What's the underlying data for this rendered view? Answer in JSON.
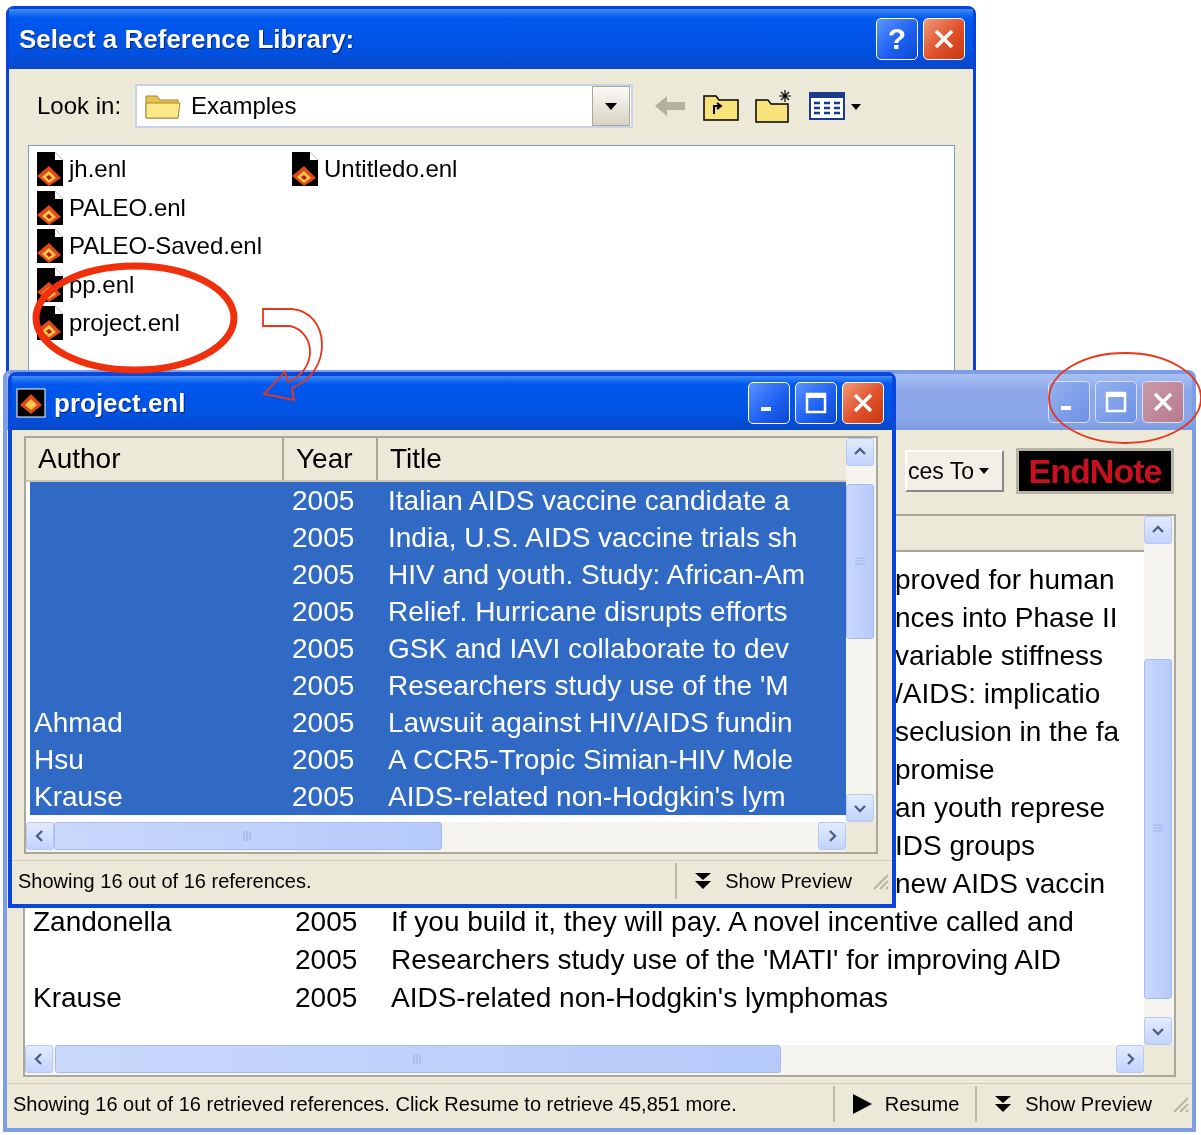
{
  "dialog": {
    "title": "Select a Reference Library:",
    "help_button": "?",
    "look_in": {
      "label": "Look in:",
      "value": "Examples"
    },
    "file_columns": [
      [
        "jh.enl",
        "PALEO.enl",
        "PALEO-Saved.enl",
        "pp.enl",
        "project.enl"
      ],
      [
        "Untitledo.enl"
      ]
    ]
  },
  "library_window": {
    "active": false,
    "toolbar_button": "ces To",
    "logo": "EndNote",
    "rows": [
      {
        "kind": "partial",
        "title": "proved for human"
      },
      {
        "kind": "partial",
        "title": "nces into Phase II"
      },
      {
        "kind": "partial",
        "title": "variable stiffness"
      },
      {
        "kind": "partial",
        "title": "/AIDS: implicatio"
      },
      {
        "kind": "partial",
        "title": "seclusion in the fa"
      },
      {
        "kind": "partial",
        "title": "promise"
      },
      {
        "kind": "partial",
        "title": "an youth represe"
      },
      {
        "kind": "partial",
        "title": "IDS groups"
      },
      {
        "kind": "partial",
        "title": "new AIDS vaccin"
      },
      {
        "kind": "full",
        "author": "Zandonella",
        "year": "2005",
        "title": "If you build it, they will pay. A novel incentive called and"
      },
      {
        "kind": "full",
        "year": "2005",
        "title": "Researchers study use of the 'MATI' for improving AID"
      },
      {
        "kind": "full",
        "author": "Krause",
        "year": "2005",
        "title": "AIDS-related non-Hodgkin's lymphomas"
      }
    ],
    "status": "Showing 16 out of 16 retrieved references. Click Resume to retrieve 45,851 more.",
    "status_buttons": [
      {
        "kind": "resume",
        "label": "Resume"
      },
      {
        "kind": "preview",
        "label": "Show Preview"
      }
    ]
  },
  "project_window": {
    "active": true,
    "title": "project.enl",
    "columns": [
      "Author",
      "Year",
      "Title"
    ],
    "rows": [
      {
        "year": "2005",
        "title": "Italian AIDS vaccine candidate a",
        "selected": true
      },
      {
        "year": "2005",
        "title": "India, U.S. AIDS vaccine trials sh",
        "selected": true
      },
      {
        "year": "2005",
        "title": "HIV and youth. Study: African-Am",
        "selected": true
      },
      {
        "year": "2005",
        "title": "Relief. Hurricane disrupts efforts",
        "selected": true
      },
      {
        "year": "2005",
        "title": "GSK and IAVI collaborate to dev",
        "selected": true
      },
      {
        "year": "2005",
        "title": "Researchers study use of the 'M",
        "selected": true
      },
      {
        "author": "Ahmad",
        "year": "2005",
        "title": "Lawsuit against HIV/AIDS fundin",
        "selected": true
      },
      {
        "author": "Hsu",
        "year": "2005",
        "title": "A CCR5-Tropic Simian-HIV Mole",
        "selected": true
      },
      {
        "author": "Krause",
        "year": "2005",
        "title": "AIDS-related non-Hodgkin's lym",
        "selected": true
      }
    ],
    "status": "Showing 16 out of 16 references.",
    "status_buttons": [
      {
        "kind": "preview",
        "label": "Show Preview"
      }
    ]
  }
}
